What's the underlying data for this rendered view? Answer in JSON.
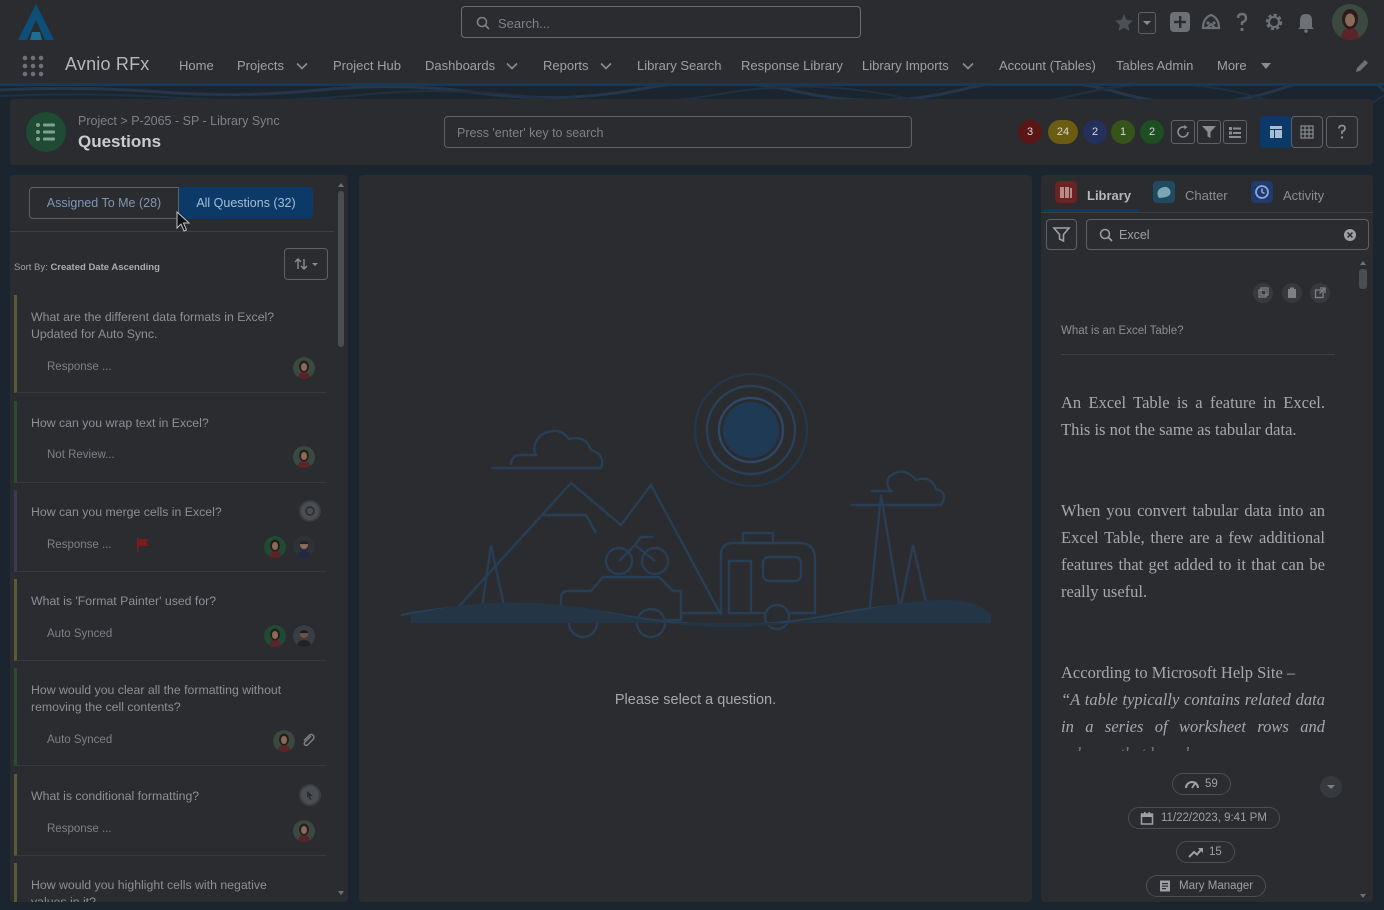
{
  "header": {
    "search_placeholder": "Search...",
    "icons": [
      "logo-icon",
      "search-icon",
      "favorites-star-icon",
      "add-icon",
      "trailhead-icon",
      "help-icon",
      "setup-gear-icon",
      "bell-icon",
      "user-avatar-icon"
    ]
  },
  "nav": {
    "app_name": "Avnio RFx",
    "items": [
      {
        "label": "Home",
        "dropdown": false
      },
      {
        "label": "Projects",
        "dropdown": true
      },
      {
        "label": "Project Hub",
        "dropdown": false
      },
      {
        "label": "Dashboards",
        "dropdown": true
      },
      {
        "label": "Reports",
        "dropdown": true
      },
      {
        "label": "Library Search",
        "dropdown": false
      },
      {
        "label": "Response Library",
        "dropdown": false
      },
      {
        "label": "Library Imports",
        "dropdown": true
      },
      {
        "label": "Account (Tables)",
        "dropdown": false
      },
      {
        "label": "Tables Admin",
        "dropdown": false
      },
      {
        "label": "More",
        "dropdown": true
      }
    ]
  },
  "page": {
    "breadcrumb": {
      "root": "Project",
      "sep": ">",
      "project": "P-2065 - SP - Library Sync"
    },
    "title": "Questions",
    "search_placeholder": "Press 'enter' key to search",
    "badges": [
      {
        "value": "3",
        "color": "#5a1614"
      },
      {
        "value": "24",
        "color": "#6b5c12"
      },
      {
        "value": "2",
        "color": "#24305c"
      },
      {
        "value": "1",
        "color": "#355419"
      },
      {
        "value": "2",
        "color": "#1e4f23"
      }
    ]
  },
  "left": {
    "tabs": [
      "Assigned To Me (28)",
      "All Questions (32)"
    ],
    "sort_prefix": "Sort By:",
    "sort_value": "Created Date Ascending",
    "questions": [
      {
        "text": "What are the different data formats in Excel? Updated for Auto Sync.",
        "status": "Response ...",
        "accent": "#5b5a36"
      },
      {
        "text": "How can you wrap text in Excel?",
        "status": "Not Review...",
        "accent": "#2e4a34"
      },
      {
        "text": "How can you merge cells in Excel?",
        "status": "Response ...",
        "accent": "#3b3a57"
      },
      {
        "text": "What is 'Format Painter' used for?",
        "status": "Auto Synced",
        "accent": "#5b5a36"
      },
      {
        "text": "How would you clear all the formatting without removing the cell contents?",
        "status": "Auto Synced",
        "accent": "#2e4a34"
      },
      {
        "text": "What is conditional formatting?",
        "status": "Response ...",
        "accent": "#5b5a36"
      },
      {
        "text": "How would you highlight cells with negative values in it?",
        "status": "",
        "accent": "#5b5a36"
      }
    ]
  },
  "center": {
    "empty_message": "Please select a question."
  },
  "right": {
    "tabs": [
      {
        "label": "Library",
        "color": "#6b2222"
      },
      {
        "label": "Chatter",
        "color": "#1f4a5f"
      },
      {
        "label": "Activity",
        "color": "#1f3a6b"
      }
    ],
    "search_value": "Excel",
    "question": "What is an Excel Table?",
    "answer": {
      "p1": "An Excel Table is a feature in Excel. This is not the same as tabular data.",
      "p2": "When you convert tabular data into an Excel Table, there are a few additional features that get added to it that can be really useful.",
      "p3_lead": "According to Microsoft Help Site –",
      "p3_quote": "“A table typically contains related data in a series of worksheet rows and columns that have been"
    },
    "meta": {
      "views": "59",
      "date": "11/22/2023, 9:41 PM",
      "usage": "15",
      "owner": "Mary Manager"
    }
  }
}
